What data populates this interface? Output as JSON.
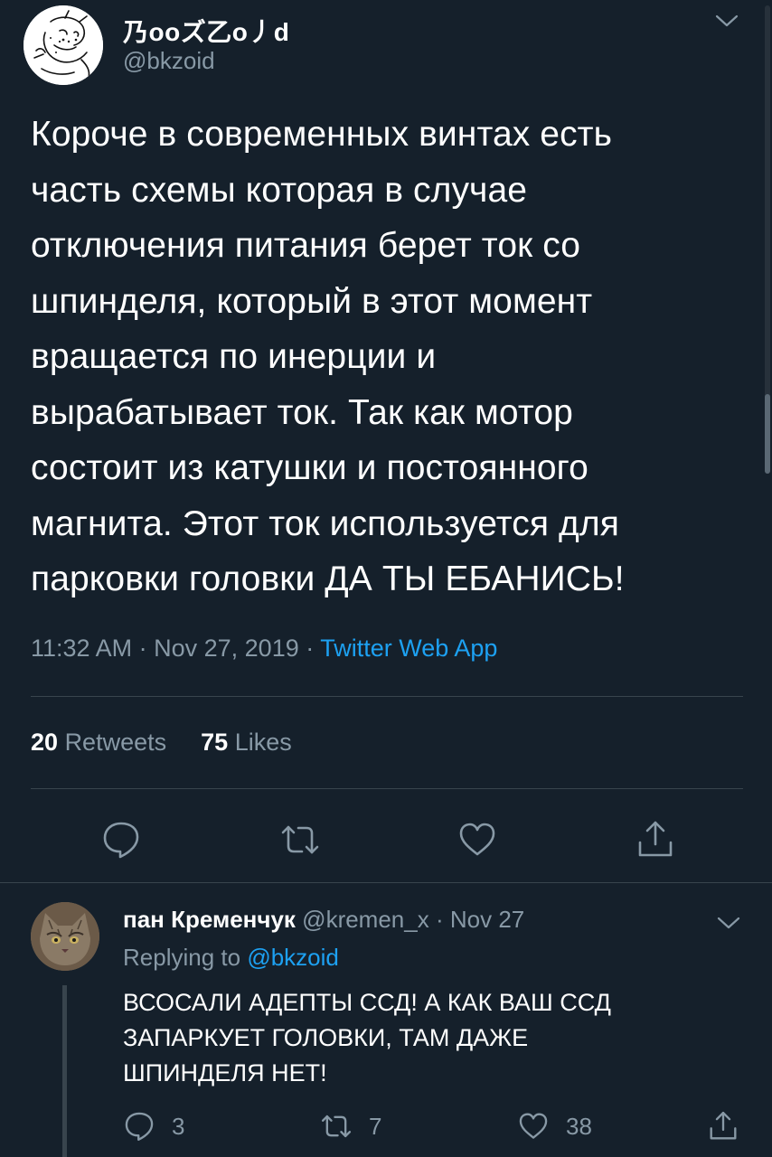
{
  "main_tweet": {
    "display_name": "乃ooズ乙o丿d",
    "handle": "@bkzoid",
    "text_lines": [
      "Короче в современных винтах есть",
      "часть схемы которая в случае",
      "отключения питания берет ток со",
      "шпинделя, который в этот момент",
      "вращается по инерции и",
      "вырабатывает ток. Так как мотор",
      "состоит из катушки и постоянного",
      "магнита. Этот ток используется для",
      "парковки головки ДА ТЫ ЕБАНИСЬ!"
    ],
    "time": "11:32 AM",
    "date": "Nov 27, 2019",
    "separator": "·",
    "source": "Twitter Web App",
    "retweets_count": "20",
    "retweets_label": "Retweets",
    "likes_count": "75",
    "likes_label": "Likes",
    "actions": {
      "reply_icon": "reply-icon",
      "retweet_icon": "retweet-icon",
      "like_icon": "heart-icon",
      "share_icon": "share-icon"
    }
  },
  "reply_tweet": {
    "display_name": "пан Кременчук",
    "handle": "@kremen_x",
    "separator": "·",
    "date": "Nov 27",
    "replying_prefix": "Replying to",
    "replying_to": "@bkzoid",
    "text_lines": [
      "ВСОСАЛИ АДЕПТЫ ССД! А КАК ВАШ ССД",
      "ЗАПАРКУЕТ ГОЛОВКИ, ТАМ ДАЖЕ",
      "ШПИНДЕЛЯ НЕТ!"
    ],
    "reply_count": "3",
    "retweet_count": "7",
    "like_count": "38"
  },
  "colors": {
    "background": "#15202b",
    "secondary_text": "#8899a6",
    "link": "#1da1f2",
    "divider": "#38444d"
  }
}
